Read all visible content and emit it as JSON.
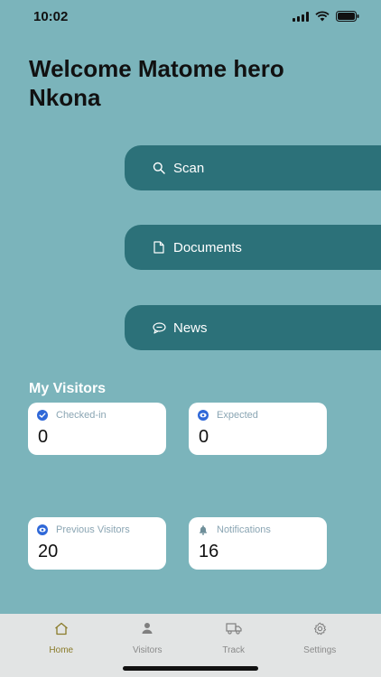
{
  "status_bar": {
    "time": "10:02"
  },
  "welcome_text": "Welcome Matome hero Nkona",
  "actions": {
    "scan": "Scan",
    "documents": "Documents",
    "news": "News"
  },
  "visitors": {
    "title": "My Visitors",
    "cards": [
      {
        "label": "Checked-in",
        "value": "0",
        "icon": "check-circle-icon"
      },
      {
        "label": "Expected",
        "value": "0",
        "icon": "eye-icon"
      },
      {
        "label": "Previous Visitors",
        "value": "20",
        "icon": "eye-icon"
      },
      {
        "label": "Notifications",
        "value": "16",
        "icon": "bell-icon"
      }
    ]
  },
  "tabs": [
    {
      "label": "Home",
      "icon": "home-icon",
      "active": true
    },
    {
      "label": "Visitors",
      "icon": "person-icon",
      "active": false
    },
    {
      "label": "Track",
      "icon": "truck-icon",
      "active": false
    },
    {
      "label": "Settings",
      "icon": "gear-icon",
      "active": false
    }
  ],
  "colors": {
    "background": "#7bb4bb",
    "button": "#2c7179",
    "active_tab": "#8a7b2a",
    "icon_blue": "#2f68d8"
  }
}
